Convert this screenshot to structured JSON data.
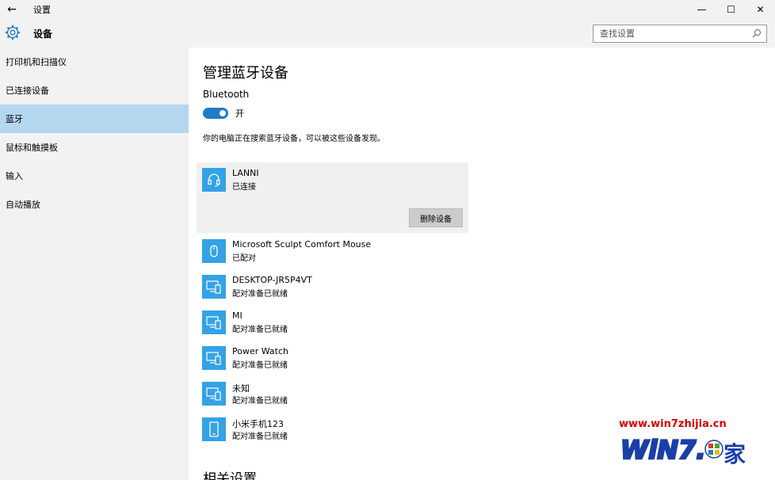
{
  "window": {
    "title": "设置",
    "back_glyph": "←",
    "minimize_glyph": "—",
    "maximize_glyph": "☐",
    "close_glyph": "✕"
  },
  "header": {
    "app_name": "设备",
    "search_placeholder": "查找设置"
  },
  "sidebar": {
    "items": [
      {
        "label": "打印机和扫描仪",
        "active": false
      },
      {
        "label": "已连接设备",
        "active": false
      },
      {
        "label": "蓝牙",
        "active": true
      },
      {
        "label": "鼠标和触摸板",
        "active": false
      },
      {
        "label": "输入",
        "active": false
      },
      {
        "label": "自动播放",
        "active": false
      }
    ]
  },
  "main": {
    "title": "管理蓝牙设备",
    "bluetooth_label": "Bluetooth",
    "toggle_state": "开",
    "description": "你的电脑正在搜索蓝牙设备，可以被这些设备发现。",
    "remove_button": "删除设备",
    "related_title": "相关设置",
    "devices": [
      {
        "name": "LANNI",
        "status": "已连接",
        "icon": "headset-icon"
      },
      {
        "name": "Microsoft Sculpt Comfort Mouse",
        "status": "已配对",
        "icon": "mouse-icon"
      },
      {
        "name": "DESKTOP-JR5P4VT",
        "status": "配对准备已就绪",
        "icon": "devices-icon"
      },
      {
        "name": "MI",
        "status": "配对准备已就绪",
        "icon": "devices-icon"
      },
      {
        "name": "Power Watch",
        "status": "配对准备已就绪",
        "icon": "devices-icon"
      },
      {
        "name": "未知",
        "status": "配对准备已就绪",
        "icon": "devices-icon"
      },
      {
        "name": "小米手机123",
        "status": "配对准备已就绪",
        "icon": "phone-icon"
      }
    ]
  },
  "watermark": {
    "url": "www.win7zhijia.cn",
    "logo_text": "WiN7.",
    "logo_suffix": "家"
  },
  "colors": {
    "accent": "#1e7bc8",
    "device_icon_bg": "#34a2e6",
    "sidebar_active": "#b3d7ee",
    "chrome_bg": "#f2f2f2",
    "watermark_red": "#d40000",
    "watermark_blue": "#1a3fa8"
  }
}
